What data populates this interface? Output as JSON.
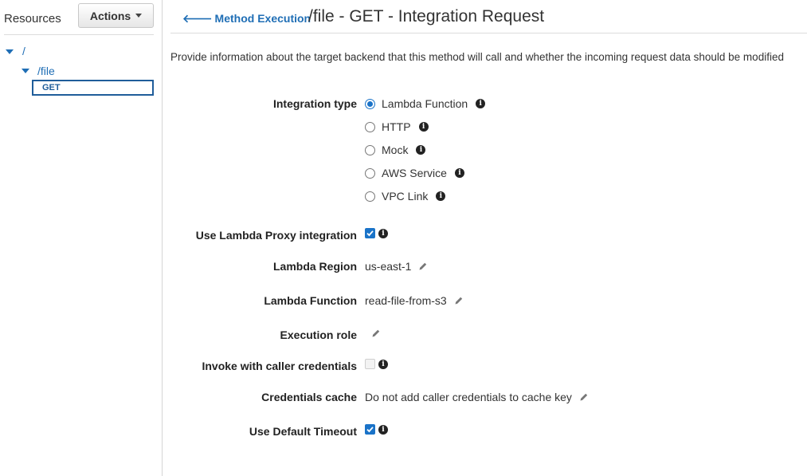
{
  "sidebar": {
    "resources_label": "Resources",
    "actions_label": "Actions",
    "tree": [
      {
        "label": "/"
      },
      {
        "label": "/file"
      },
      {
        "label": "GET"
      }
    ]
  },
  "header": {
    "back_link": "Method Execution",
    "title": "/file - GET - Integration Request"
  },
  "description": "Provide information about the target backend that this method will call and whether the incoming request data should be modified",
  "form": {
    "integration_type": {
      "label": "Integration type",
      "options": [
        {
          "label": "Lambda Function",
          "selected": true
        },
        {
          "label": "HTTP",
          "selected": false
        },
        {
          "label": "Mock",
          "selected": false
        },
        {
          "label": "AWS Service",
          "selected": false
        },
        {
          "label": "VPC Link",
          "selected": false
        }
      ]
    },
    "proxy": {
      "label": "Use Lambda Proxy integration",
      "checked": true
    },
    "region": {
      "label": "Lambda Region",
      "value": "us-east-1"
    },
    "function": {
      "label": "Lambda Function",
      "value": "read-file-from-s3"
    },
    "role": {
      "label": "Execution role",
      "value": ""
    },
    "caller_credentials": {
      "label": "Invoke with caller credentials",
      "checked": false
    },
    "credentials_cache": {
      "label": "Credentials cache",
      "value": "Do not add caller credentials to cache key"
    },
    "default_timeout": {
      "label": "Use Default Timeout",
      "checked": true
    }
  },
  "icons": {
    "info": "info-icon",
    "edit": "pencil-icon",
    "back": "arrow-left-icon",
    "expand": "triangle-down-icon"
  },
  "colors": {
    "link": "#1f6eb5",
    "accent": "#1a73c8",
    "selected_box": "#1f5d9a"
  }
}
